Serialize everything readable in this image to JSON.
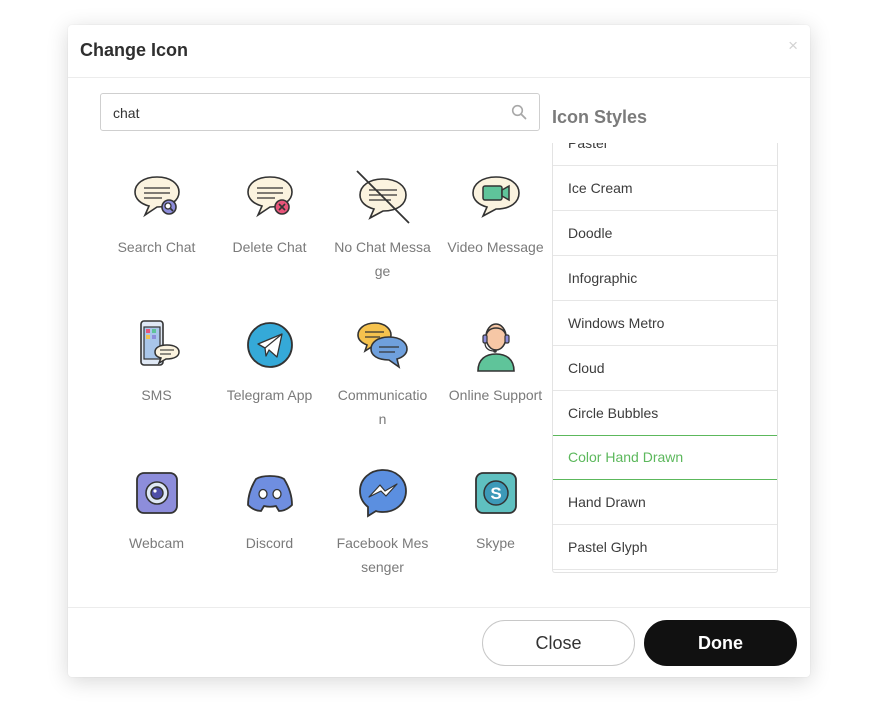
{
  "dialog": {
    "title": "Change Icon",
    "close_glyph": "×"
  },
  "search": {
    "value": "chat",
    "placeholder": "",
    "icon": "search-icon"
  },
  "icons": [
    {
      "label": "Search Chat",
      "icon": "search-chat-icon"
    },
    {
      "label": "Delete Chat",
      "icon": "delete-chat-icon"
    },
    {
      "label": "No Chat Message",
      "icon": "no-chat-message-icon"
    },
    {
      "label": "Video Message",
      "icon": "video-message-icon"
    },
    {
      "label": "SMS",
      "icon": "sms-icon"
    },
    {
      "label": "Telegram App",
      "icon": "telegram-icon"
    },
    {
      "label": "Communication",
      "icon": "communication-icon"
    },
    {
      "label": "Online Support",
      "icon": "online-support-icon"
    },
    {
      "label": "Webcam",
      "icon": "webcam-icon"
    },
    {
      "label": "Discord",
      "icon": "discord-icon"
    },
    {
      "label": "Facebook Messenger",
      "icon": "facebook-messenger-icon"
    },
    {
      "label": "Skype",
      "icon": "skype-icon"
    }
  ],
  "icon_styles": {
    "title": "Icon Styles",
    "items": [
      "Pastel",
      "Ice Cream",
      "Doodle",
      "Infographic",
      "Windows Metro",
      "Cloud",
      "Circle Bubbles",
      "Color Hand Drawn",
      "Hand Drawn",
      "Pastel Glyph"
    ],
    "selected": "Color Hand Drawn"
  },
  "footer": {
    "close_label": "Close",
    "done_label": "Done"
  },
  "colors": {
    "accent_selected": "#5cb85c",
    "done_button": "#111111"
  }
}
